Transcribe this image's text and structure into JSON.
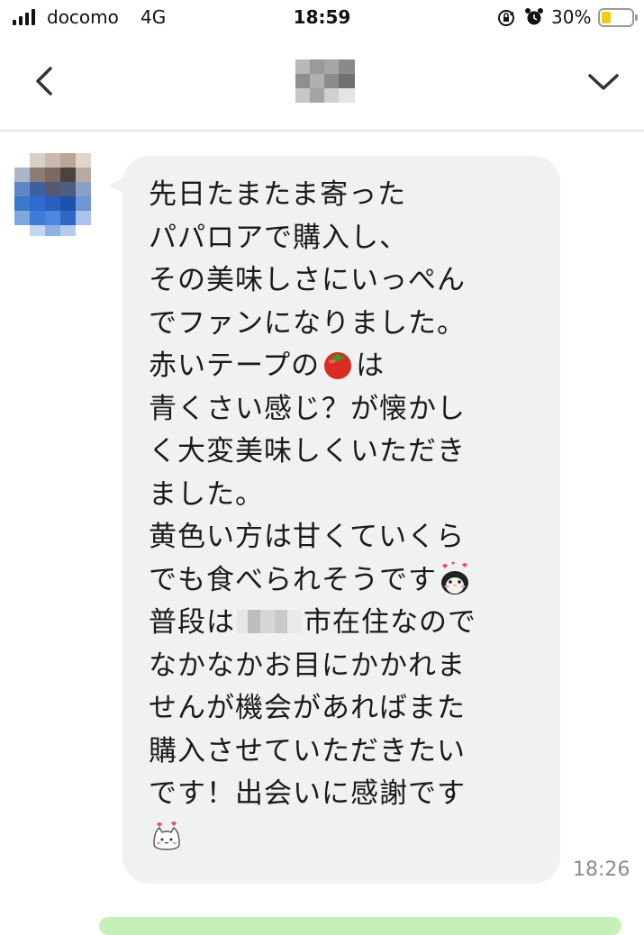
{
  "status_bar": {
    "carrier": "docomo",
    "network": "4G",
    "time": "18:59",
    "battery_percent": "30%",
    "battery_level": 0.3
  },
  "nav": {
    "back_icon": "chevron-left-icon",
    "dropdown_icon": "chevron-down-icon"
  },
  "message": {
    "lines": [
      "先日たまたま寄った",
      "パパロアで購入し、",
      "その美味しさにいっぺん",
      "でファンになりました。",
      "赤いテープの",
      "青くさい感じ？が懐かし",
      "く大変美味しくいただき",
      "ました。",
      "黄色い方は甘くていくら",
      "でも食べられそうです",
      "普段は",
      "市在住なので",
      "なかなかお目にかかれま",
      "せんが機会があればまた",
      "購入させていただきたい",
      "です！出会いに感謝です"
    ],
    "tail_text": "は",
    "emojis": [
      "tomato-emoji",
      "penguin-emoji",
      "cat-emoji"
    ],
    "timestamp": "18:26"
  },
  "colors": {
    "bubble": "#f0f1f3",
    "battery": "#f2cc14",
    "timestamp": "#8b8b8b",
    "outgoing_bubble": "#c7f0b8"
  }
}
